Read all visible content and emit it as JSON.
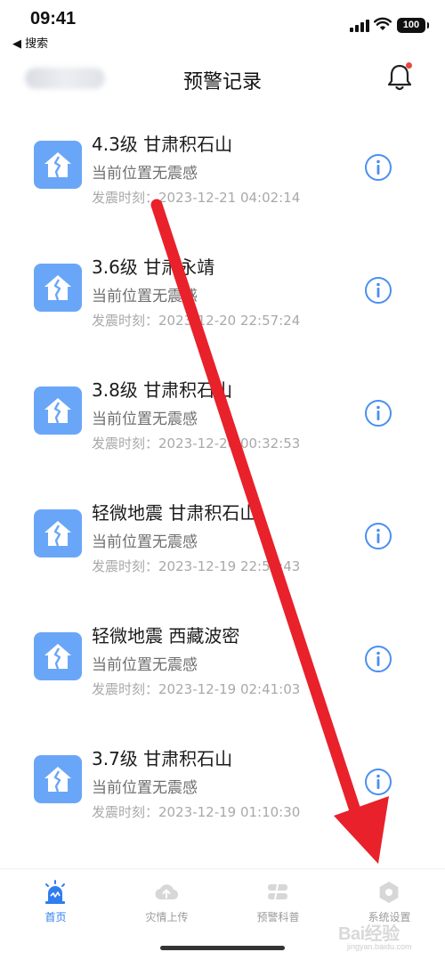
{
  "status_bar": {
    "time": "09:41",
    "back_label": "◀ 搜索",
    "battery": "100"
  },
  "header": {
    "title": "预警记录"
  },
  "records": [
    {
      "title": "4.3级 甘肃积石山",
      "status": "当前位置无震感",
      "time_label": "发震时刻：",
      "time_value": "2023-12-21 04:02:14"
    },
    {
      "title": "3.6级 甘肃永靖",
      "status": "当前位置无震感",
      "time_label": "发震时刻：",
      "time_value": "2023-12-20 22:57:24"
    },
    {
      "title": "3.8级 甘肃积石山",
      "status": "当前位置无震感",
      "time_label": "发震时刻：",
      "time_value": "2023-12-20 00:32:53"
    },
    {
      "title": "轻微地震 甘肃积石山",
      "status": "当前位置无震感",
      "time_label": "发震时刻：",
      "time_value": "2023-12-19 22:55:43"
    },
    {
      "title": "轻微地震 西藏波密",
      "status": "当前位置无震感",
      "time_label": "发震时刻：",
      "time_value": "2023-12-19 02:41:03"
    },
    {
      "title": "3.7级 甘肃积石山",
      "status": "当前位置无震感",
      "time_label": "发震时刻：",
      "time_value": "2023-12-19 01:10:30"
    }
  ],
  "tabs": [
    {
      "label": "首页",
      "icon": "alarm-icon",
      "active": true
    },
    {
      "label": "灾情上传",
      "icon": "cloud-upload-icon",
      "active": false
    },
    {
      "label": "预警科普",
      "icon": "book-icon",
      "active": false
    },
    {
      "label": "系统设置",
      "icon": "settings-icon",
      "active": false
    }
  ],
  "colors": {
    "accent": "#2f7df1",
    "record_icon_bg": "#6aa6f8",
    "info_icon": "#4a8ff0",
    "annotation_arrow": "#e8212b",
    "notification_dot": "#e8463f"
  },
  "watermark": {
    "brand": "Bai经验",
    "url": "jingyan.baidu.com"
  }
}
